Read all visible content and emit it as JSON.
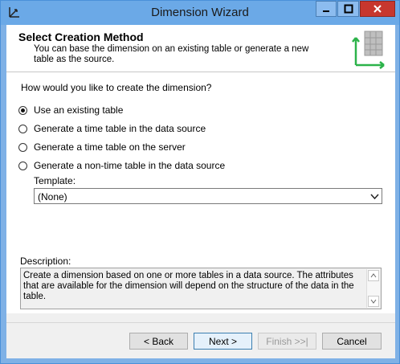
{
  "window": {
    "title": "Dimension Wizard"
  },
  "header": {
    "title": "Select Creation Method",
    "description": "You can base the dimension on an existing table or generate a new table as the source."
  },
  "question": "How would you like to create the dimension?",
  "options": [
    {
      "label": "Use an existing table",
      "checked": true
    },
    {
      "label": "Generate a time table in the data source",
      "checked": false
    },
    {
      "label": "Generate a time table on the server",
      "checked": false
    },
    {
      "label": "Generate a non-time table in the data source",
      "checked": false
    }
  ],
  "template": {
    "label": "Template:",
    "value": "(None)"
  },
  "description": {
    "label": "Description:",
    "text": "Create a dimension based on one or more tables in a data source. The attributes that are available for the dimension will depend on the structure of the data in the table."
  },
  "buttons": {
    "back": "< Back",
    "next": "Next >",
    "finish": "Finish >>|",
    "cancel": "Cancel"
  }
}
